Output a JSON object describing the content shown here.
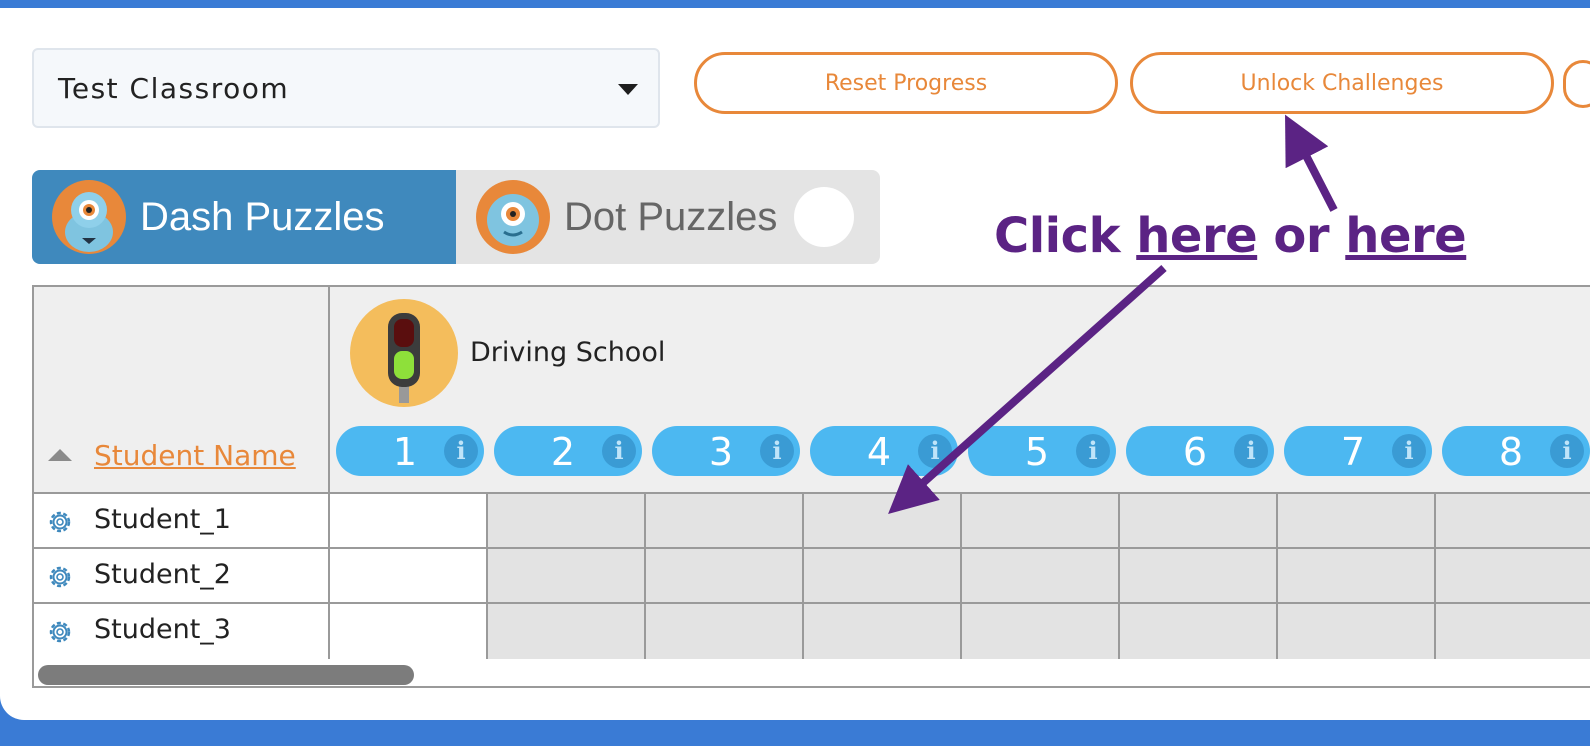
{
  "classroom": {
    "selected": "Test Classroom"
  },
  "buttons": {
    "reset": "Reset Progress",
    "unlock": "Unlock Challenges"
  },
  "tabs": [
    {
      "label": "Dash Puzzles",
      "active": true
    },
    {
      "label": "Dot Puzzles",
      "active": false
    }
  ],
  "grid": {
    "header": {
      "student_name": "Student Name",
      "level_title": "Driving School"
    },
    "puzzles": [
      "1",
      "2",
      "3",
      "4",
      "5",
      "6",
      "7",
      "8"
    ],
    "info_glyph": "i",
    "students": [
      "Student_1",
      "Student_2",
      "Student_3"
    ]
  },
  "annotation": {
    "click": "Click",
    "here1": "here",
    "or": "or",
    "here2": "here"
  },
  "colors": {
    "accent_orange": "#e8883a",
    "tab_blue": "#3f89bd",
    "pill_blue": "#4cb8f1",
    "annotation_purple": "#5b2384",
    "frame_blue": "#3a7bd5"
  },
  "icons": [
    "chevron-down-icon",
    "dash-robot-icon",
    "dot-robot-icon",
    "traffic-light-icon",
    "info-icon",
    "gear-icon",
    "sort-up-icon"
  ]
}
